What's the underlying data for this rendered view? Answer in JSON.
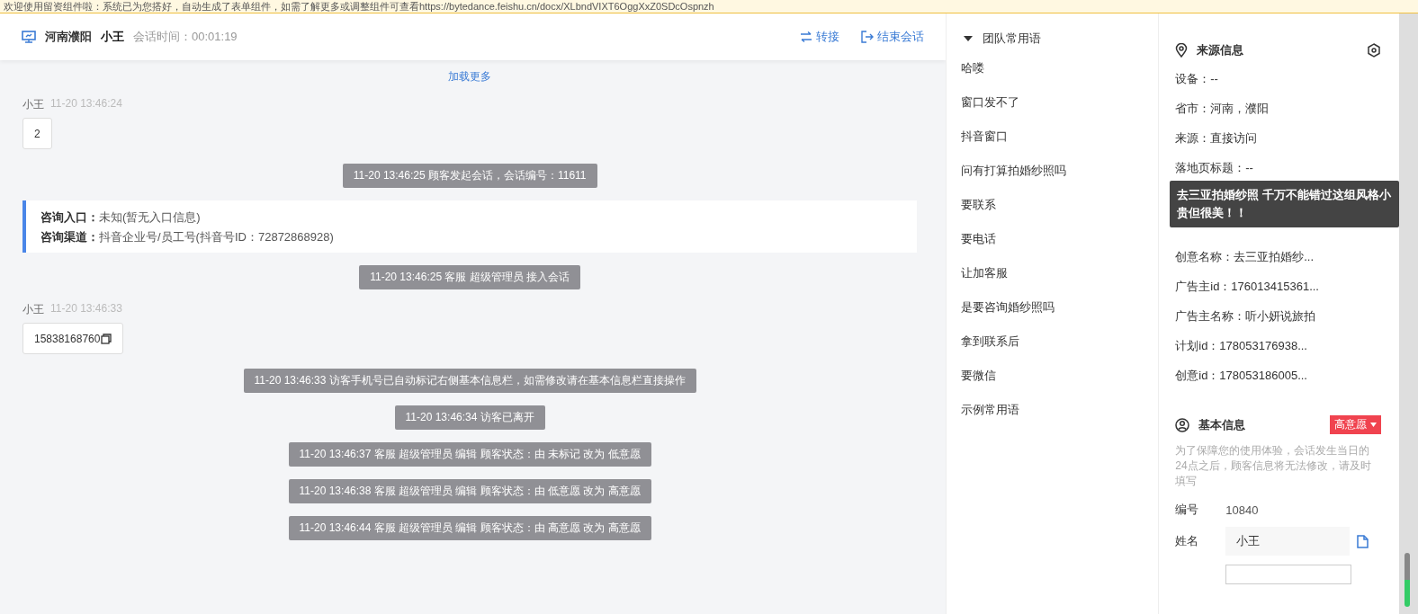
{
  "banner": {
    "text": "欢迎使用留资组件啦：系统已为您搭好，自动生成了表单组件，如需了解更多或调整组件可查看https://bytedance.feishu.cn/docx/XLbndVIXT6OggXxZ0SDcOspnzh"
  },
  "header": {
    "location": "河南濮阳",
    "name": "小王",
    "duration": "会话时间：00:01:19",
    "actions": [
      {
        "kind": "transfer",
        "label": "转接"
      },
      {
        "kind": "end",
        "label": "结束会话"
      }
    ]
  },
  "load_more": "加载更多",
  "messages": [
    {
      "kind": "user",
      "sender": "小王",
      "time": "11-20 13:46:24",
      "text": "2",
      "copyable": false
    },
    {
      "kind": "system",
      "text": "11-20 13:46:25 顾客发起会话，会话编号：11611"
    },
    {
      "kind": "info",
      "lines": [
        {
          "label": "咨询入口：",
          "value": "未知(暂无入口信息)"
        },
        {
          "label": "咨询渠道：",
          "value": "抖音企业号/员工号(抖音号ID：72872868928)"
        }
      ]
    },
    {
      "kind": "system",
      "text": "11-20 13:46:25 客服 超级管理员 接入会话"
    },
    {
      "kind": "user",
      "sender": "小王",
      "time": "11-20 13:46:33",
      "text": "15838168760",
      "copyable": true
    },
    {
      "kind": "system",
      "text": "11-20 13:46:33 访客手机号已自动标记右侧基本信息栏，如需修改请在基本信息栏直接操作"
    },
    {
      "kind": "system",
      "text": "11-20 13:46:34 访客已离开"
    },
    {
      "kind": "system",
      "text": "11-20 13:46:37 客服 超级管理员 编辑 顾客状态：由 未标记 改为 低意愿"
    },
    {
      "kind": "system",
      "text": "11-20 13:46:38 客服 超级管理员 编辑 顾客状态：由 低意愿 改为 高意愿"
    },
    {
      "kind": "system",
      "text": "11-20 13:46:44 客服 超级管理员 编辑 顾客状态：由 高意愿 改为 高意愿"
    }
  ],
  "phrases": {
    "title": "团队常用语",
    "expanded": true,
    "items": [
      "哈喽",
      "窗口发不了",
      "抖音窗口",
      "问有打算拍婚纱照吗",
      "要联系",
      "要电话",
      "让加客服",
      "是要咨询婚纱照吗",
      "拿到联系后",
      "要微信",
      "示例常用语"
    ]
  },
  "source": {
    "title": "来源信息",
    "rows_before": [
      "设备：--",
      "省市：河南，濮阳",
      "来源：直接访问",
      "落地页标题：--"
    ],
    "tooltip": "去三亚拍婚纱照 千万不能错过这组风格小贵但很美！！",
    "rows_after": [
      "创意名称：去三亚拍婚纱...",
      "广告主id：176013415361...",
      "广告主名称：听小妍说旅拍",
      "计划id：178053176938...",
      "创意id：178053186005..."
    ]
  },
  "basic": {
    "title": "基本信息",
    "intent": {
      "label": "高意愿",
      "color": "#f0434f"
    },
    "notice": "为了保障您的使用体验，会话发生当日的24点之后，顾客信息将无法修改，请及时填写",
    "fields": [
      {
        "kind": "text",
        "label": "编号",
        "value": "10840"
      },
      {
        "kind": "input",
        "label": "姓名",
        "value": "小王"
      }
    ]
  }
}
